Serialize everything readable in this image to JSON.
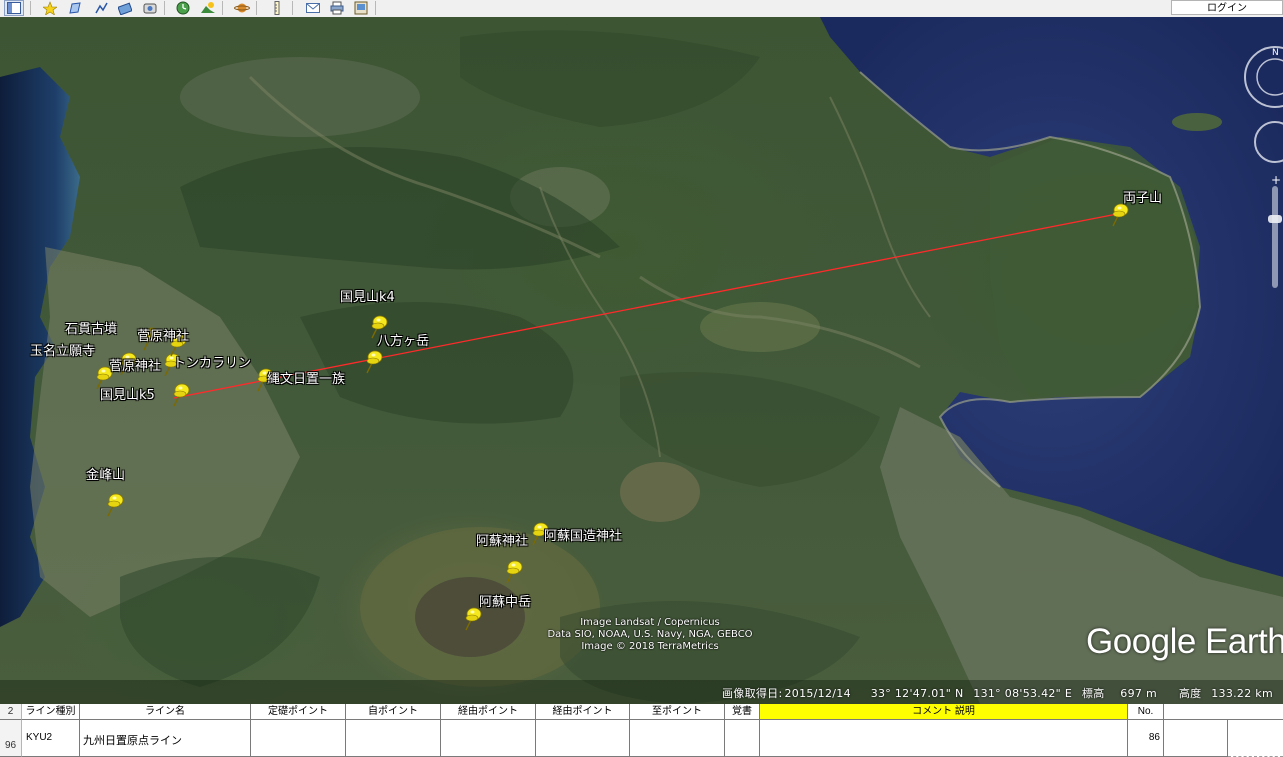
{
  "toolbar": {
    "icons": [
      "sidebar-toggle-icon",
      "add-placemark-icon",
      "add-polygon-icon",
      "add-path-icon",
      "add-image-overlay-icon",
      "record-tour-icon",
      "historical-imagery-icon",
      "sunlight-icon",
      "planets-icon",
      "ruler-icon",
      "email-icon",
      "print-icon",
      "save-image-icon"
    ],
    "login_label": "ログイン"
  },
  "map": {
    "placemarks": [
      {
        "id": "ryoshisan",
        "label": "両子山"
      },
      {
        "id": "kunimiyama-k4",
        "label": "国見山k4"
      },
      {
        "id": "happougatake",
        "label": "八方ヶ岳"
      },
      {
        "id": "jomon-hioki",
        "label": "縄文日置一族"
      },
      {
        "id": "tonkarin",
        "label": "トンカラリン"
      },
      {
        "id": "sugawara-1",
        "label": "菅原神社"
      },
      {
        "id": "sugawara-2",
        "label": "菅原神社"
      },
      {
        "id": "ishinuki",
        "label": "石貫古墳"
      },
      {
        "id": "tamana-ryuganji",
        "label": "玉名立願寺"
      },
      {
        "id": "kunimiyama-k5",
        "label": "国見山k5"
      },
      {
        "id": "kinposan",
        "label": "金峰山"
      },
      {
        "id": "aso-kokuzo",
        "label": "阿蘇国造神社"
      },
      {
        "id": "aso-jinja",
        "label": "阿蘇神社"
      },
      {
        "id": "aso-nakadake",
        "label": "阿蘇中岳"
      }
    ],
    "attribution": [
      "Image Landsat / Copernicus",
      "Data SIO, NOAA, U.S. Navy, NGA, GEBCO",
      "Image © 2018 TerraMetrics"
    ],
    "logo": "Google Earth",
    "line_color": "#ff2a2a",
    "status": {
      "date_label": "画像取得日:",
      "date": "2015/12/14",
      "lat": "33° 12'47.01\" N",
      "lon": "131° 08'53.42\" E",
      "elev_label": "標高",
      "elev": "697 m",
      "alt_label": "高度",
      "alt": "133.22 km"
    }
  },
  "sheet": {
    "header_row_num": "2",
    "headers": [
      "ライン種別",
      "ライン名",
      "定礎ポイント",
      "自ポイント",
      "経由ポイント",
      "経由ポイント",
      "至ポイント",
      "覚書",
      "コメント 説明",
      "No."
    ],
    "highlight_color": "#ffff00",
    "data_row_num": "96",
    "row": [
      "KYU2",
      "九州日置原点ライン",
      "",
      "",
      "",
      "",
      "",
      "",
      "",
      "86"
    ]
  }
}
